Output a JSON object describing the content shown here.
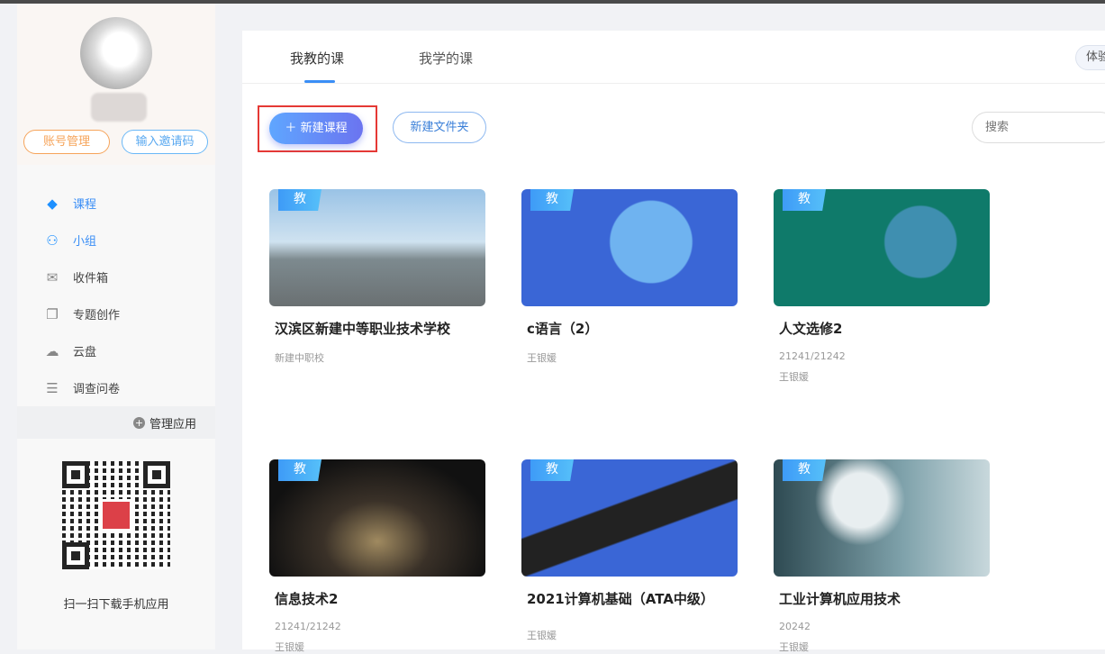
{
  "sidebar": {
    "account_btn": "账号管理",
    "invite_btn": "输入邀请码",
    "items": [
      {
        "label": "课程",
        "icon": "course"
      },
      {
        "label": "小组",
        "icon": "group"
      },
      {
        "label": "收件箱",
        "icon": "inbox"
      },
      {
        "label": "专题创作",
        "icon": "topic"
      },
      {
        "label": "云盘",
        "icon": "cloud"
      },
      {
        "label": "调查问卷",
        "icon": "list"
      }
    ],
    "manage_apps": "管理应用",
    "qr_text": "扫一扫下载手机应用"
  },
  "main": {
    "tabs": [
      {
        "label": "我教的课"
      },
      {
        "label": "我学的课"
      }
    ],
    "try_label": "体验",
    "new_course": "新建课程",
    "new_folder": "新建文件夹",
    "search_placeholder": "搜索",
    "badge": "教",
    "courses": [
      {
        "title": "汉滨区新建中等职业技术学校",
        "sub": "新建中职校",
        "sub2": ""
      },
      {
        "title": "c语言（2）",
        "sub": "王银媛",
        "sub2": ""
      },
      {
        "title": "人文选修2",
        "sub": "21241/21242",
        "sub2": "王银媛"
      },
      {
        "title": "信息技术2",
        "sub": "21241/21242",
        "sub2": "王银媛"
      },
      {
        "title": "2021计算机基础（ATA中级）",
        "sub": "王银媛",
        "sub2": ""
      },
      {
        "title": "工业计算机应用技术",
        "sub": "20242",
        "sub2": "王银媛"
      }
    ]
  }
}
